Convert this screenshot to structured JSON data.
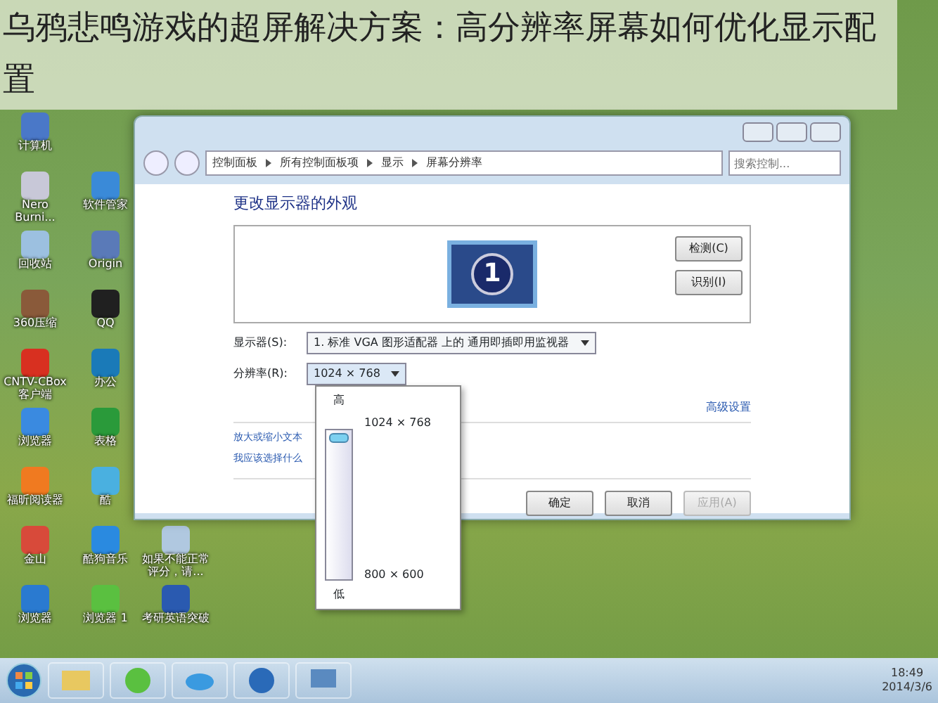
{
  "banner": {
    "title": "乌鸦悲鸣游戏的超屏解决方案：高分辨率屏幕如何优化显示配置"
  },
  "desktop_icons": [
    [
      {
        "label": "计算机",
        "color": "#4a78c8"
      }
    ],
    [
      {
        "label": "Nero Burni...",
        "color": "#c8c8d8"
      },
      {
        "label": "软件管家",
        "color": "#3a8ad8"
      }
    ],
    [
      {
        "label": "回收站",
        "color": "#9cc0e0"
      },
      {
        "label": "Origin",
        "color": "#5a7ab8"
      }
    ],
    [
      {
        "label": "360压缩",
        "color": "#8a5a3a"
      },
      {
        "label": "QQ",
        "color": "#202020"
      }
    ],
    [
      {
        "label": "CNTV-CBox 客户端",
        "color": "#d83020"
      },
      {
        "label": "办公",
        "color": "#1a7ab8"
      }
    ],
    [
      {
        "label": "浏览器",
        "color": "#3a8ae0"
      },
      {
        "label": "表格",
        "color": "#2a9a3a"
      }
    ],
    [
      {
        "label": "福昕阅读器",
        "color": "#f07a20"
      },
      {
        "label": "酷",
        "color": "#4ab0e0"
      }
    ],
    [
      {
        "label": "金山",
        "color": "#d84a3a"
      },
      {
        "label": "酷狗音乐",
        "color": "#2a8ae0"
      },
      {
        "label": "如果不能正常评分，请...",
        "color": "#b0c8e0"
      }
    ],
    [
      {
        "label": "浏览器",
        "color": "#2a7ad0"
      },
      {
        "label": "浏览器 1",
        "color": "#5ac040"
      },
      {
        "label": "考研英语突破",
        "color": "#2a5ab0"
      }
    ]
  ],
  "window": {
    "breadcrumb": [
      "控制面板",
      "所有控制面板项",
      "显示",
      "屏幕分辨率"
    ],
    "search": {
      "placeholder": "搜索控制..."
    },
    "heading": "更改显示器的外观",
    "monitor_number": "1",
    "side_buttons": [
      {
        "label": "检测(C)"
      },
      {
        "label": "识别(I)"
      }
    ],
    "display": {
      "label": "显示器(S):",
      "value": "1. 标准 VGA 图形适配器 上的 通用即插即用监视器"
    },
    "resolution": {
      "label": "分辨率(R):",
      "value": "1024 × 768",
      "expanded": true,
      "popup": {
        "high": "高",
        "top_option": "1024 × 768",
        "bottom_option": "800 × 600",
        "low": "低",
        "level": 1
      }
    },
    "advanced_link": "高级设置",
    "links": [
      "放大或缩小文本",
      "我应该选择什么"
    ],
    "buttons": [
      {
        "label": "确定",
        "disabled": false
      },
      {
        "label": "取消",
        "disabled": false
      },
      {
        "label": "应用(A)",
        "disabled": true
      }
    ]
  },
  "taskbar": {
    "clock": {
      "time": "18:49",
      "date": "2014/3/6"
    }
  }
}
